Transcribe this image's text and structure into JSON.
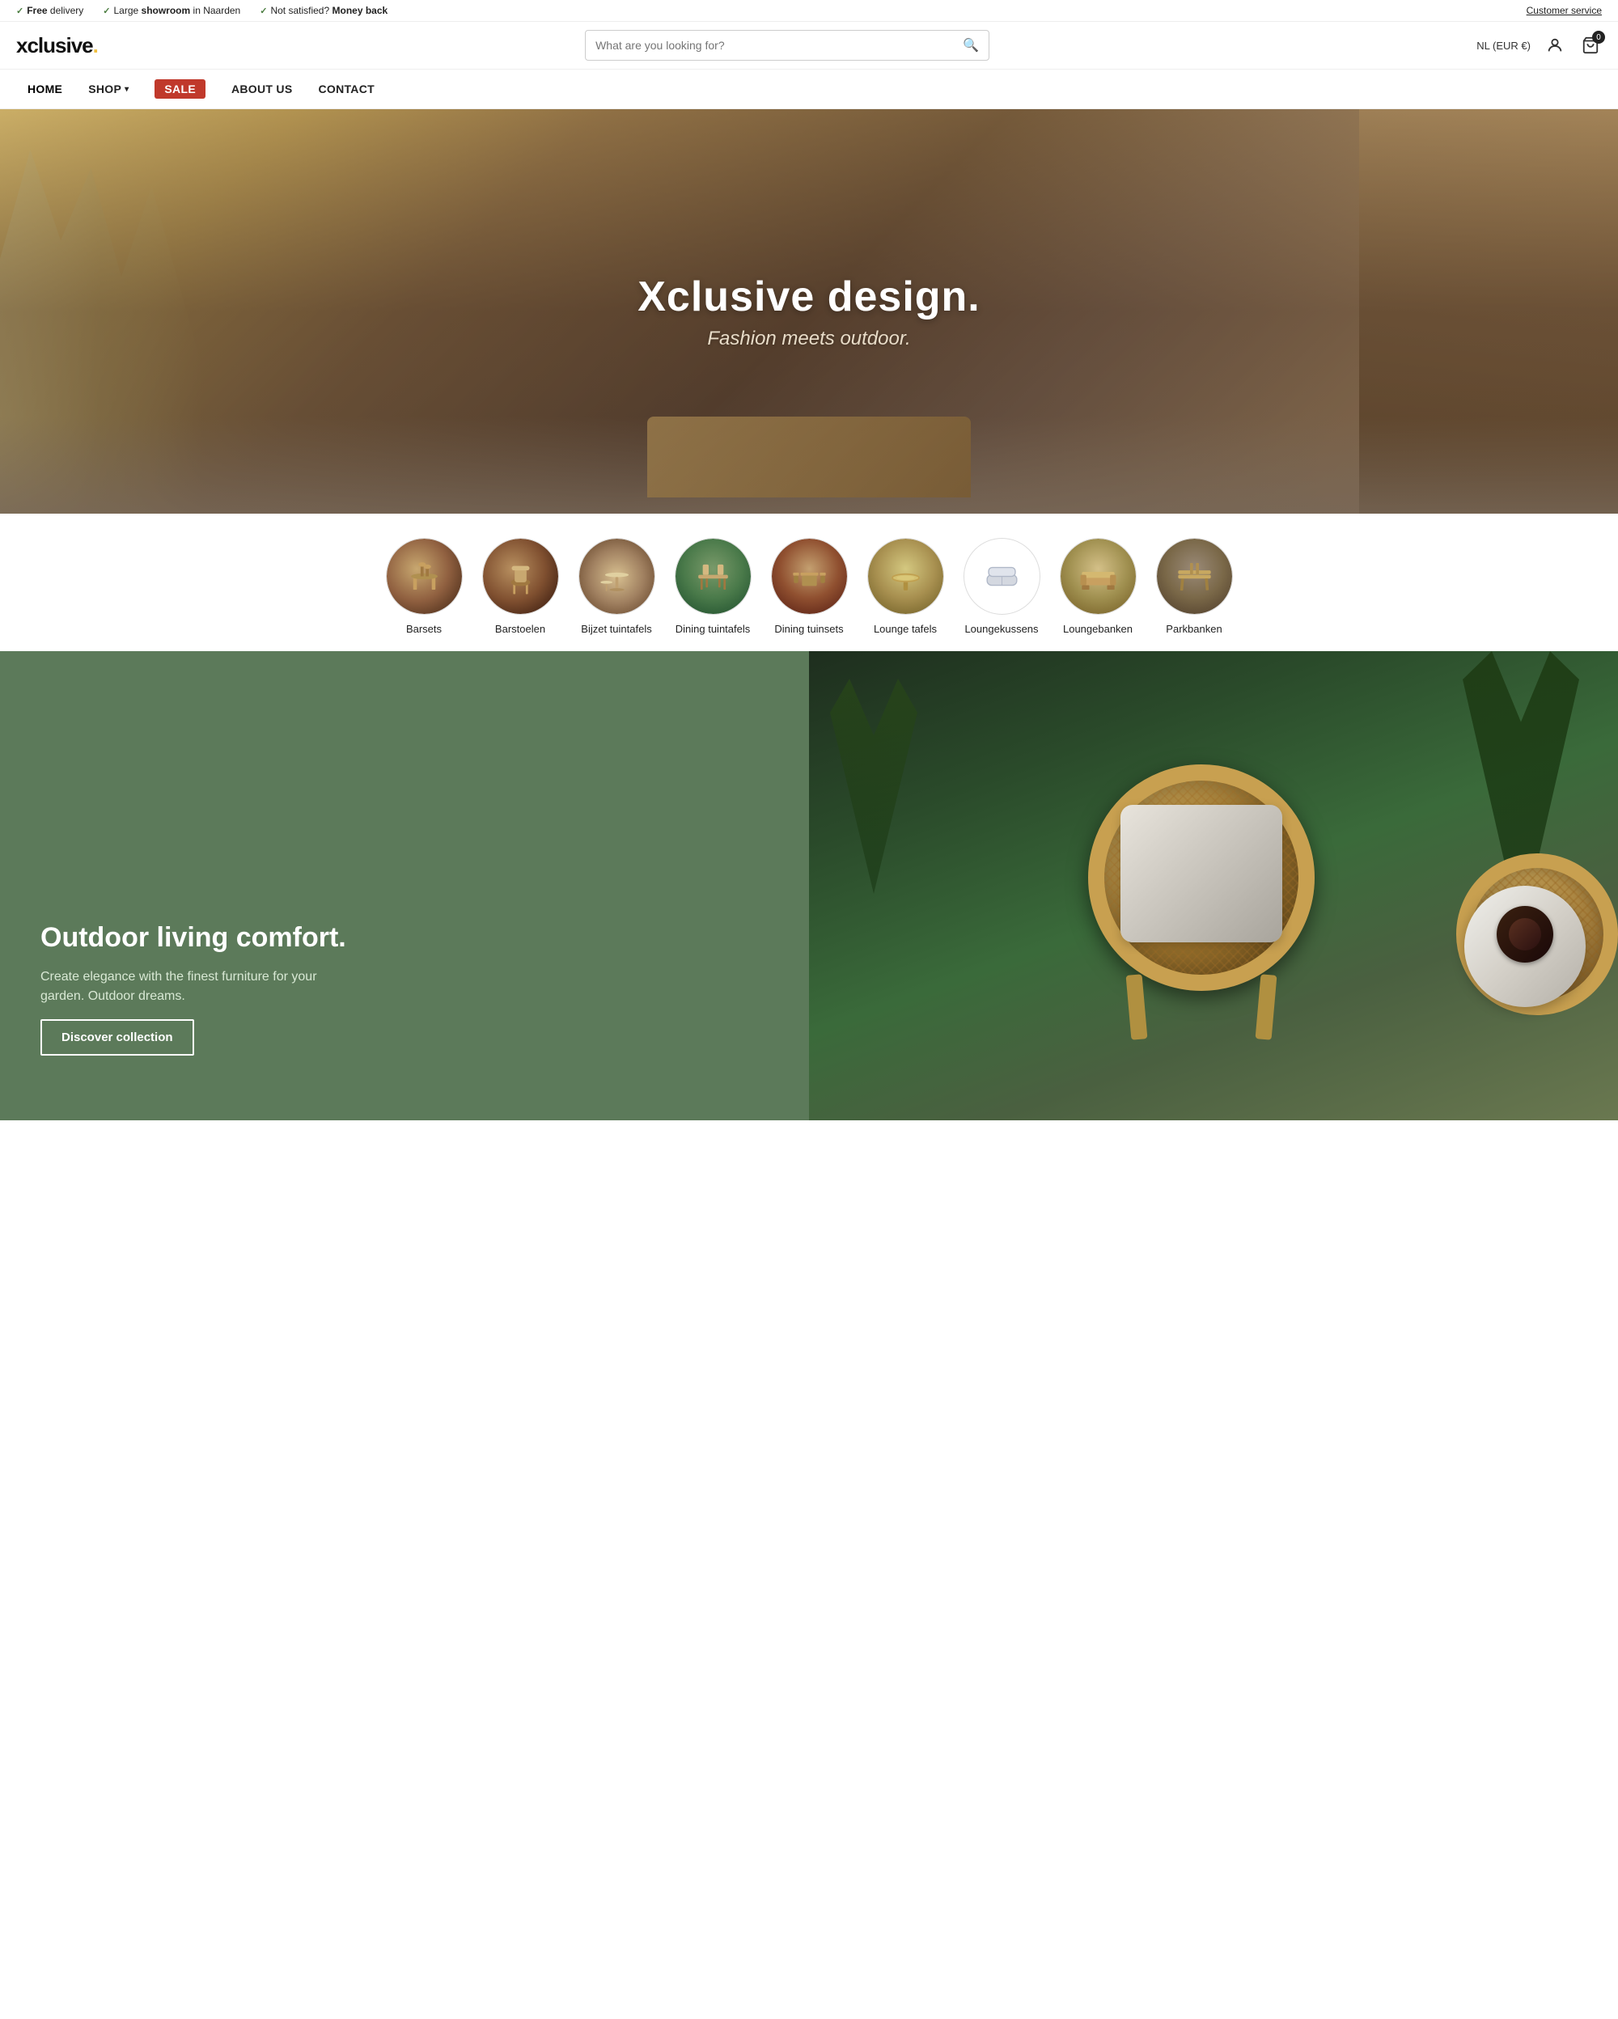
{
  "announcement": {
    "items": [
      {
        "checkmark": "✓",
        "text": "Free delivery",
        "bold": "Free"
      },
      {
        "checkmark": "✓",
        "text": "Large showroom in Naarden",
        "bold": "showroom"
      },
      {
        "checkmark": "✓",
        "text": "Not satisfied? Money back",
        "bold": "Money back"
      }
    ],
    "customer_service": "Customer service"
  },
  "header": {
    "logo": "xclusive.",
    "search_placeholder": "What are you looking for?",
    "currency": "NL (EUR €)",
    "cart_count": "0"
  },
  "nav": {
    "items": [
      {
        "label": "HOME",
        "active": true,
        "has_dropdown": false,
        "is_sale": false
      },
      {
        "label": "SHOP",
        "active": false,
        "has_dropdown": true,
        "is_sale": false
      },
      {
        "label": "SALE",
        "active": false,
        "has_dropdown": false,
        "is_sale": true
      },
      {
        "label": "ABOUT US",
        "active": false,
        "has_dropdown": false,
        "is_sale": false
      },
      {
        "label": "CONTACT",
        "active": false,
        "has_dropdown": false,
        "is_sale": false
      }
    ]
  },
  "hero": {
    "title": "Xclusive design.",
    "subtitle": "Fashion meets outdoor."
  },
  "categories": [
    {
      "label": "Barsets",
      "color_class": "cat-barsets"
    },
    {
      "label": "Barstoelen",
      "color_class": "cat-barstoelen"
    },
    {
      "label": "Bijzet tuintafels",
      "color_class": "cat-bijzet"
    },
    {
      "label": "Dining tuintafels",
      "color_class": "cat-dining-tafels"
    },
    {
      "label": "Dining tuinsets",
      "color_class": "cat-dining-tuinsets"
    },
    {
      "label": "Lounge tafels",
      "color_class": "cat-lounge-tafels"
    },
    {
      "label": "Loungekussens",
      "color_class": "cat-loungekussens"
    },
    {
      "label": "Loungebanken",
      "color_class": "cat-loungebanken"
    },
    {
      "label": "Parkbanken",
      "color_class": "cat-parkbanken"
    }
  ],
  "promo": {
    "heading": "Outdoor living comfort.",
    "text": "Create elegance with the finest furniture for your garden. Outdoor dreams.",
    "button_label": "Discover collection"
  }
}
